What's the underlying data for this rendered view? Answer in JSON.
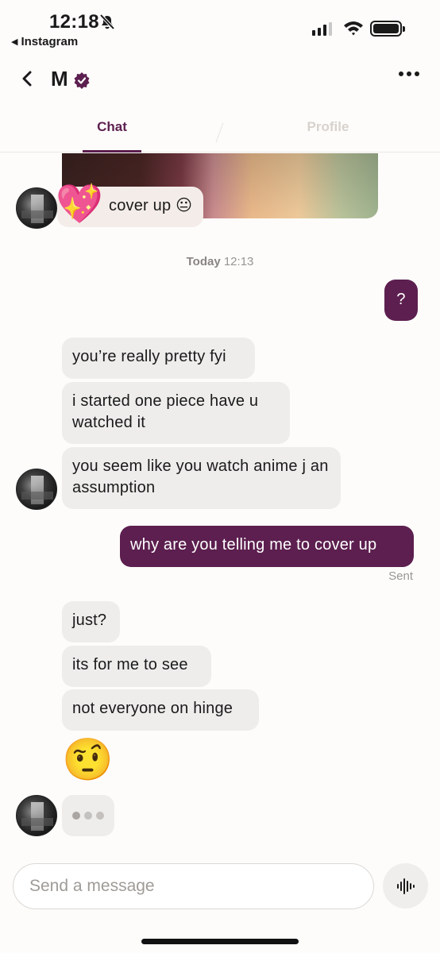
{
  "status_bar": {
    "time": "12:18",
    "back_app": "Instagram"
  },
  "header": {
    "contact_name": "M",
    "verified_icon": "verified-badge-icon",
    "colors": {
      "brand": "#5c1f4f"
    }
  },
  "tabs": [
    {
      "label": "Chat",
      "active": true
    },
    {
      "label": "Profile",
      "active": false
    }
  ],
  "messages": {
    "reply_text": "cover up",
    "reply_emoji": "😐",
    "heart_emoji": "💖",
    "timestamp_day": "Today",
    "timestamp_time": "12:13",
    "m1": "?",
    "m2": "you’re really pretty fyi",
    "m3": "i started one piece have u watched it",
    "m4": "you seem like you watch anime j an assumption",
    "m5": "why are you telling me to cover up",
    "m5_status": "Sent",
    "m6": "just?",
    "m7": "its for me to see",
    "m8": "not everyone on hinge",
    "m9_emoji": "🤨"
  },
  "composer": {
    "placeholder": "Send a message",
    "voice_icon": "waveform-icon"
  }
}
